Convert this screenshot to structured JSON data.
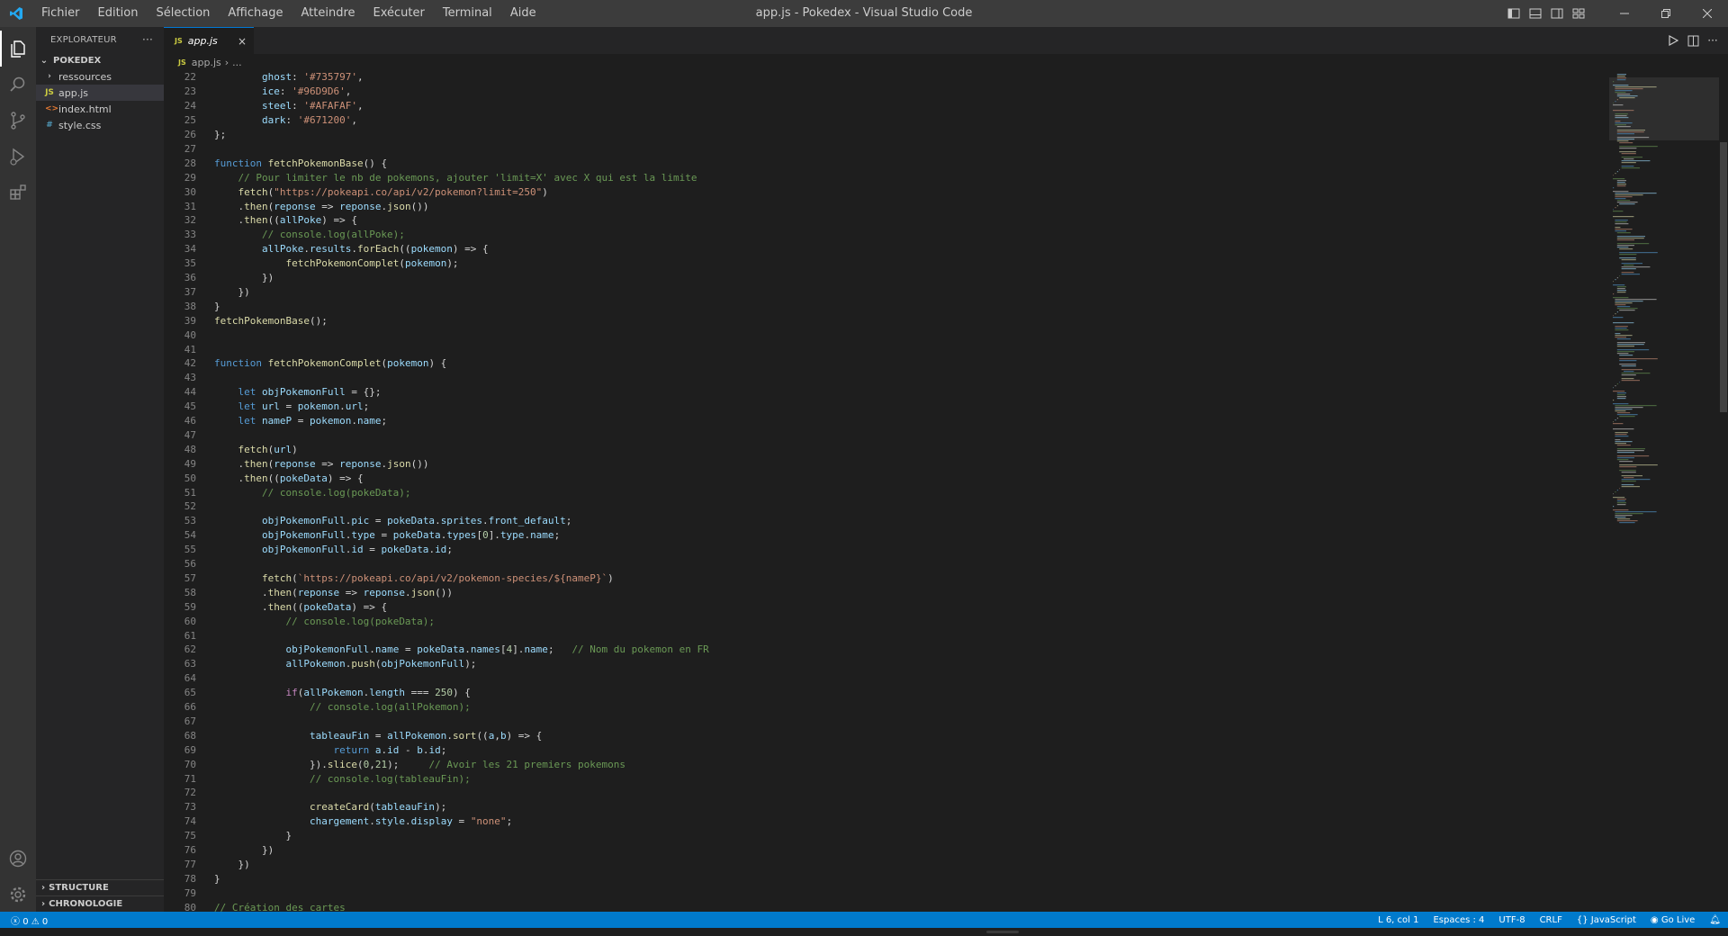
{
  "titlebar": {
    "menu": [
      "Fichier",
      "Edition",
      "Sélection",
      "Affichage",
      "Atteindre",
      "Exécuter",
      "Terminal",
      "Aide"
    ],
    "title": "app.js - Pokedex - Visual Studio Code"
  },
  "activity": [
    "explorer-icon",
    "search-icon",
    "source-control-icon",
    "run-debug-icon",
    "extensions-icon",
    "account-icon",
    "gear-icon"
  ],
  "sidebar": {
    "header": "EXPLORATEUR",
    "more": "···",
    "project": "POKEDEX",
    "items": [
      {
        "label": "ressources",
        "icon": "›",
        "kind": "folder"
      },
      {
        "label": "app.js",
        "icon": "JS",
        "kind": "js"
      },
      {
        "label": "index.html",
        "icon": "<>",
        "kind": "html"
      },
      {
        "label": "style.css",
        "icon": "#",
        "kind": "css"
      }
    ],
    "sections": [
      "STRUCTURE",
      "CHRONOLOGIE"
    ]
  },
  "tab": {
    "icon": "JS",
    "label": "app.js",
    "close": "×"
  },
  "breadcrumb": {
    "file": "app.js",
    "sep": "›",
    "rest": "..."
  },
  "colors": {
    "keyword": "#569cd6",
    "control": "#c586c0",
    "function": "#dcdcaa",
    "variable": "#9cdcfe",
    "string": "#ce9178",
    "number": "#b5cea8",
    "comment": "#6a9955",
    "statusbar": "#007acc"
  },
  "code": [
    {
      "n": 22,
      "t": "        ghost: '#735797',"
    },
    {
      "n": 23,
      "t": "        ice: '#96D9D6',"
    },
    {
      "n": 24,
      "t": "        steel: '#AFAFAF',"
    },
    {
      "n": 25,
      "t": "        dark: '#671200',"
    },
    {
      "n": 26,
      "t": "};"
    },
    {
      "n": 27,
      "t": ""
    },
    {
      "n": 28,
      "t": "function fetchPokemonBase() {"
    },
    {
      "n": 29,
      "t": "    // Pour limiter le nb de pokemons, ajouter 'limit=X' avec X qui est la limite"
    },
    {
      "n": 30,
      "t": "    fetch(\"https://pokeapi.co/api/v2/pokemon?limit=250\")"
    },
    {
      "n": 31,
      "t": "    .then(reponse => reponse.json())"
    },
    {
      "n": 32,
      "t": "    .then((allPoke) => {"
    },
    {
      "n": 33,
      "t": "        // console.log(allPoke);"
    },
    {
      "n": 34,
      "t": "        allPoke.results.forEach((pokemon) => {"
    },
    {
      "n": 35,
      "t": "            fetchPokemonComplet(pokemon);"
    },
    {
      "n": 36,
      "t": "        })"
    },
    {
      "n": 37,
      "t": "    })"
    },
    {
      "n": 38,
      "t": "}"
    },
    {
      "n": 39,
      "t": "fetchPokemonBase();"
    },
    {
      "n": 40,
      "t": ""
    },
    {
      "n": 41,
      "t": ""
    },
    {
      "n": 42,
      "t": "function fetchPokemonComplet(pokemon) {"
    },
    {
      "n": 43,
      "t": ""
    },
    {
      "n": 44,
      "t": "    let objPokemonFull = {};"
    },
    {
      "n": 45,
      "t": "    let url = pokemon.url;"
    },
    {
      "n": 46,
      "t": "    let nameP = pokemon.name;"
    },
    {
      "n": 47,
      "t": ""
    },
    {
      "n": 48,
      "t": "    fetch(url)"
    },
    {
      "n": 49,
      "t": "    .then(reponse => reponse.json())"
    },
    {
      "n": 50,
      "t": "    .then((pokeData) => {"
    },
    {
      "n": 51,
      "t": "        // console.log(pokeData);"
    },
    {
      "n": 52,
      "t": ""
    },
    {
      "n": 53,
      "t": "        objPokemonFull.pic = pokeData.sprites.front_default;"
    },
    {
      "n": 54,
      "t": "        objPokemonFull.type = pokeData.types[0].type.name;"
    },
    {
      "n": 55,
      "t": "        objPokemonFull.id = pokeData.id;"
    },
    {
      "n": 56,
      "t": ""
    },
    {
      "n": 57,
      "t": "        fetch(`https://pokeapi.co/api/v2/pokemon-species/${nameP}`)"
    },
    {
      "n": 58,
      "t": "        .then(reponse => reponse.json())"
    },
    {
      "n": 59,
      "t": "        .then((pokeData) => {"
    },
    {
      "n": 60,
      "t": "            // console.log(pokeData);"
    },
    {
      "n": 61,
      "t": ""
    },
    {
      "n": 62,
      "t": "            objPokemonFull.name = pokeData.names[4].name;   // Nom du pokemon en FR"
    },
    {
      "n": 63,
      "t": "            allPokemon.push(objPokemonFull);"
    },
    {
      "n": 64,
      "t": ""
    },
    {
      "n": 65,
      "t": "            if(allPokemon.length === 250) {"
    },
    {
      "n": 66,
      "t": "                // console.log(allPokemon);"
    },
    {
      "n": 67,
      "t": ""
    },
    {
      "n": 68,
      "t": "                tableauFin = allPokemon.sort((a,b) => {"
    },
    {
      "n": 69,
      "t": "                    return a.id - b.id;"
    },
    {
      "n": 70,
      "t": "                }).slice(0,21);     // Avoir les 21 premiers pokemons"
    },
    {
      "n": 71,
      "t": "                // console.log(tableauFin);"
    },
    {
      "n": 72,
      "t": ""
    },
    {
      "n": 73,
      "t": "                createCard(tableauFin);"
    },
    {
      "n": 74,
      "t": "                chargement.style.display = \"none\";"
    },
    {
      "n": 75,
      "t": "            }"
    },
    {
      "n": 76,
      "t": "        })"
    },
    {
      "n": 77,
      "t": "    })"
    },
    {
      "n": 78,
      "t": "}"
    },
    {
      "n": 79,
      "t": ""
    },
    {
      "n": 80,
      "t": "// Création des cartes"
    }
  ],
  "status": {
    "errors": "0",
    "warnings": "0",
    "position": "L 6, col 1",
    "spaces": "Espaces : 4",
    "encoding": "UTF-8",
    "eol": "CRLF",
    "language": "JavaScript",
    "golive": "Go Live"
  }
}
